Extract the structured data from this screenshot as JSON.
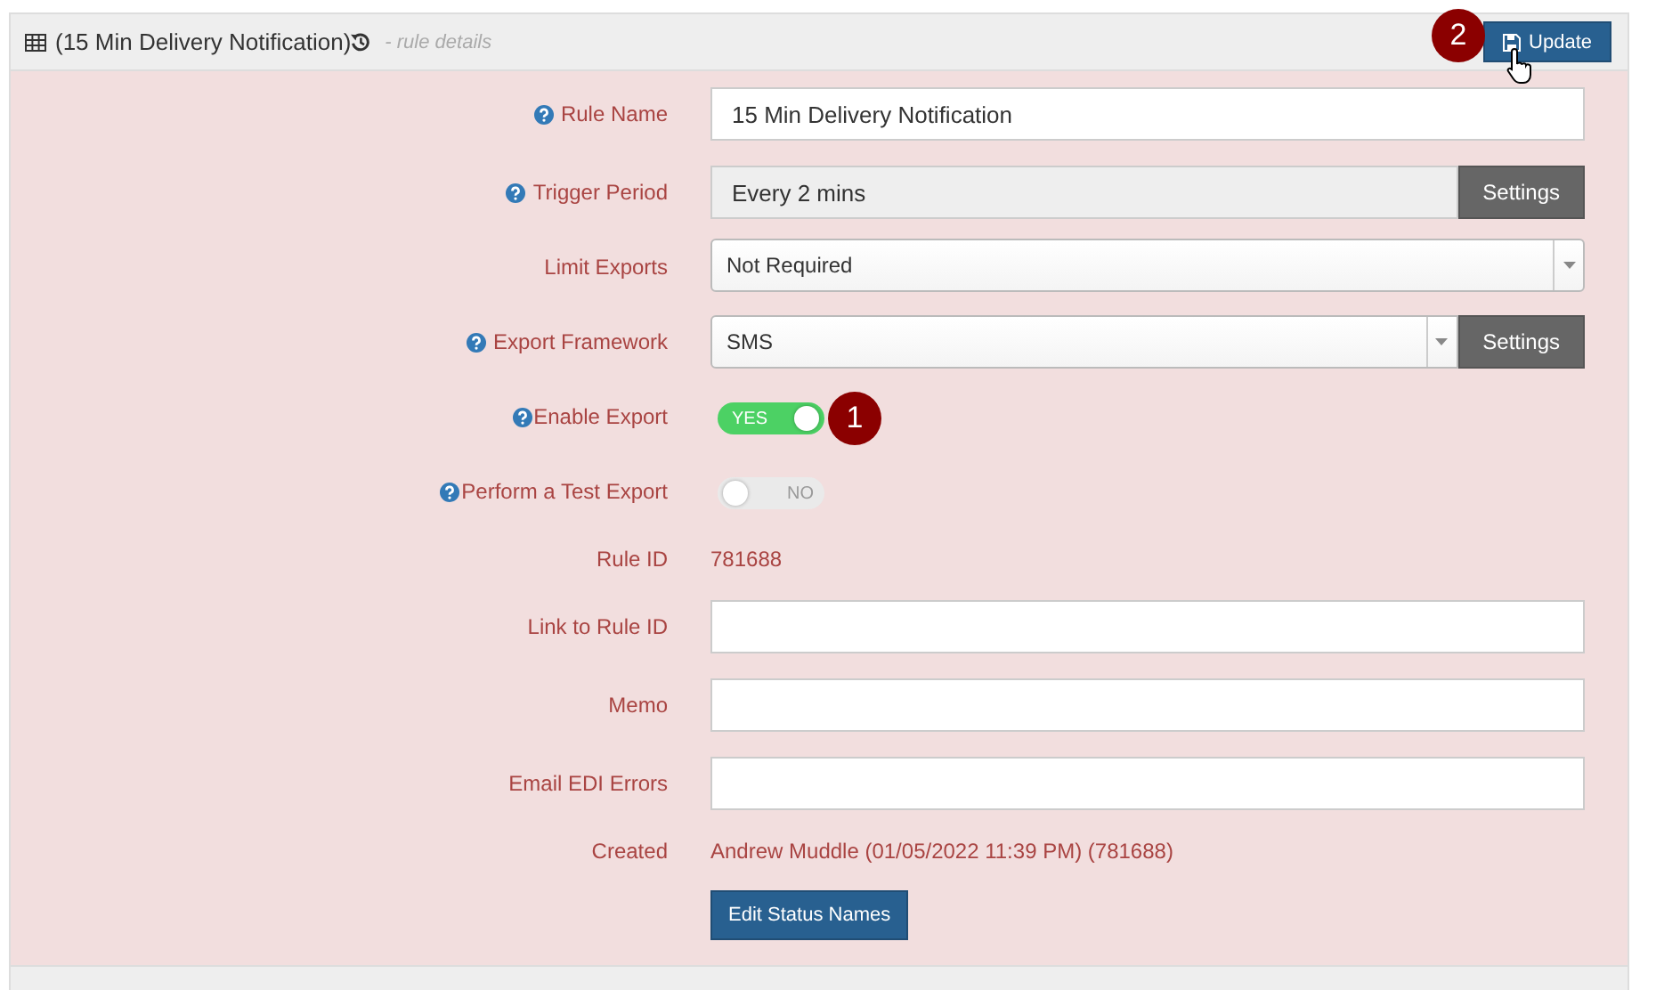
{
  "panel": {
    "title": "(15 Min Delivery Notification)",
    "subtitle": "- rule details",
    "update_button": {
      "label": "Update",
      "callout": "2"
    }
  },
  "rows": [
    {
      "kind": "input",
      "label": "Rule Name",
      "help": true,
      "value": "15 Min Delivery Notification"
    },
    {
      "kind": "readonly-settings",
      "label": "Trigger Period",
      "help": true,
      "value": "Every 2 mins",
      "button": "Settings"
    },
    {
      "kind": "select",
      "label": "Limit Exports",
      "help": false,
      "value": "Not Required"
    },
    {
      "kind": "select-settings",
      "label": "Export Framework",
      "help": true,
      "value": "SMS",
      "button": "Settings"
    },
    {
      "kind": "toggle",
      "label": "Enable Export",
      "help": true,
      "on": true,
      "text": "YES",
      "callout": "1"
    },
    {
      "kind": "toggle",
      "label": "Perform a Test Export",
      "help": true,
      "on": false,
      "text": "NO"
    },
    {
      "kind": "text",
      "label": "Rule ID",
      "help": false,
      "value": "781688"
    },
    {
      "kind": "input",
      "label": "Link to Rule ID",
      "help": false
    },
    {
      "kind": "input",
      "label": "Memo",
      "help": false
    },
    {
      "kind": "input",
      "label": "Email EDI Errors",
      "help": false
    },
    {
      "kind": "text",
      "label": "Created",
      "help": false,
      "value": "Andrew Muddle (01/05/2022 11:39 PM) (781688)"
    },
    {
      "kind": "button",
      "button": "Edit Status Names"
    }
  ]
}
